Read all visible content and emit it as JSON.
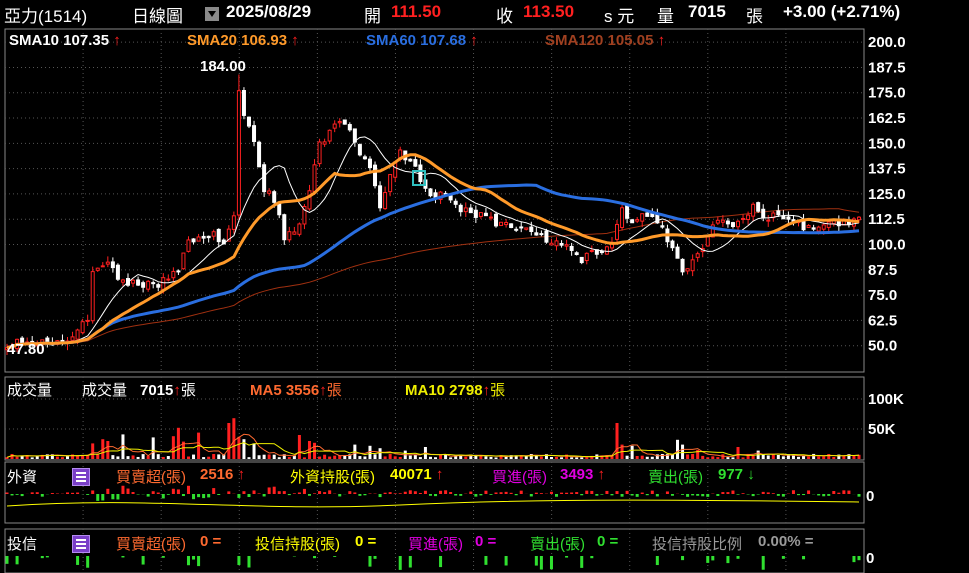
{
  "header": {
    "stock": "亞力(1514)",
    "period": "日線圖",
    "date": "2025/08/29",
    "open_label": "開",
    "open_value": "111.50",
    "close_label": "收",
    "close_value": "113.50",
    "unit_suffix": "s 元",
    "volume_label": "量",
    "volume_value": "7015",
    "volume_unit": "張",
    "change": "+3.00 (+2.71%)"
  },
  "legend": {
    "sma10": "SMA10 107.35",
    "sma20": "SMA20 106.93",
    "sma60": "SMA60 107.68",
    "sma120": "SMA120 105.05"
  },
  "annotations": {
    "high": "184.00",
    "low": "47.80"
  },
  "volume_legend": {
    "panel": "成交量",
    "label": "成交量",
    "value": "7015",
    "unit": "張",
    "ma5": "MA5 3556",
    "ma10": "MA10 2798"
  },
  "foreign_legend": {
    "panel": "外資",
    "net_label": "買賣超(張)",
    "net_value": "2516",
    "hold_label": "外資持股(張)",
    "hold_value": "40071",
    "buy_label": "買進(張)",
    "buy_value": "3493",
    "sell_label": "賣出(張)",
    "sell_value": "977"
  },
  "trust_legend": {
    "panel": "投信",
    "net_label": "買賣超(張)",
    "net_value": "0 =",
    "hold_label": "投信持股(張)",
    "hold_value": "0 =",
    "buy_label": "買進(張)",
    "buy_value": "0 =",
    "sell_label": "賣出(張)",
    "sell_value": "0 =",
    "ratio_label": "投信持股比例",
    "ratio_value": "0.00% ="
  },
  "colors": {
    "up": "#ff2020",
    "down": "#ffffff",
    "sma10": "#ffffff",
    "sma20": "#ff9a2a",
    "sma60": "#2a6ee0",
    "sma120": "#a03010",
    "grid": "#555555",
    "ma5": "#ff6a30",
    "ma10": "#f0f000",
    "buy": "#e000e0",
    "sell": "#30e030",
    "hold": "#ffff00"
  },
  "chart_data": [
    {
      "type": "line",
      "subtype": "candlestick",
      "title": "亞力(1514) 日線圖",
      "ylim": [
        37.5,
        206
      ],
      "y_ticks": [
        200.0,
        187.5,
        175.0,
        162.5,
        150.0,
        137.5,
        125.0,
        112.5,
        100.0,
        87.5,
        75.0,
        62.5,
        50.0
      ],
      "y_tick_labels": [
        "200.0",
        "187.5",
        "175.0",
        "162.5",
        "150.0",
        "137.5",
        "125.0",
        "112.5",
        "100.0",
        "87.5",
        "75.0",
        "62.5",
        "50.0"
      ],
      "grid": true,
      "bars": 170,
      "anchors": [
        [
          0,
          51
        ],
        [
          10,
          52
        ],
        [
          14,
          56
        ],
        [
          16,
          64
        ],
        [
          17,
          86
        ],
        [
          20,
          93
        ],
        [
          22,
          82
        ],
        [
          30,
          80
        ],
        [
          34,
          87
        ],
        [
          36,
          101
        ],
        [
          38,
          104
        ],
        [
          41,
          106
        ],
        [
          43,
          100
        ],
        [
          45,
          116
        ],
        [
          46,
          182
        ],
        [
          47,
          164
        ],
        [
          49,
          150
        ],
        [
          51,
          127
        ],
        [
          53,
          122
        ],
        [
          55,
          104
        ],
        [
          58,
          110
        ],
        [
          60,
          126
        ],
        [
          62,
          150
        ],
        [
          65,
          158
        ],
        [
          67,
          160
        ],
        [
          69,
          150
        ],
        [
          72,
          138
        ],
        [
          74,
          120
        ],
        [
          76,
          134
        ],
        [
          78,
          145
        ],
        [
          80,
          142
        ],
        [
          82,
          133
        ],
        [
          84,
          124
        ],
        [
          87,
          126
        ],
        [
          90,
          118
        ],
        [
          94,
          114
        ],
        [
          98,
          110
        ],
        [
          102,
          107
        ],
        [
          106,
          104
        ],
        [
          110,
          100
        ],
        [
          114,
          93
        ],
        [
          118,
          98
        ],
        [
          120,
          100
        ],
        [
          122,
          118
        ],
        [
          124,
          110
        ],
        [
          127,
          115
        ],
        [
          130,
          107
        ],
        [
          132,
          98
        ],
        [
          134,
          88
        ],
        [
          136,
          92
        ],
        [
          138,
          100
        ],
        [
          140,
          110
        ],
        [
          142,
          114
        ],
        [
          144,
          108
        ],
        [
          146,
          112
        ],
        [
          148,
          119
        ],
        [
          150,
          113
        ],
        [
          153,
          115
        ],
        [
          156,
          110
        ],
        [
          159,
          108
        ],
        [
          162,
          110
        ],
        [
          166,
          111
        ],
        [
          169,
          113.5
        ]
      ],
      "series": [
        {
          "name": "SMA10",
          "last": 107.35,
          "color": "#ffffff"
        },
        {
          "name": "SMA20",
          "last": 106.93,
          "color": "#ff9a2a"
        },
        {
          "name": "SMA60",
          "last": 107.68,
          "color": "#2a6ee0"
        },
        {
          "name": "SMA120",
          "last": 105.05,
          "color": "#a03010"
        }
      ],
      "annotations": [
        {
          "label": "184.00",
          "value": 184.0
        },
        {
          "label": "47.80",
          "value": 47.8
        }
      ]
    },
    {
      "type": "bar",
      "title": "成交量",
      "ylim": [
        0,
        135000
      ],
      "y_ticks": [
        100000,
        50000
      ],
      "y_tick_labels": [
        "100K",
        "50K"
      ],
      "last": 7015,
      "series": [
        {
          "name": "MA5",
          "last": 3556
        },
        {
          "name": "MA10",
          "last": 2798
        }
      ],
      "spikes": [
        [
          17,
          26000
        ],
        [
          19,
          33000
        ],
        [
          20,
          30000
        ],
        [
          23,
          41000
        ],
        [
          29,
          36000
        ],
        [
          33,
          38000
        ],
        [
          34,
          52000
        ],
        [
          35,
          29000
        ],
        [
          38,
          44000
        ],
        [
          44,
          60000
        ],
        [
          45,
          68000
        ],
        [
          46,
          37000
        ],
        [
          47,
          33000
        ],
        [
          49,
          26000
        ],
        [
          58,
          40000
        ],
        [
          60,
          30000
        ],
        [
          61,
          27000
        ],
        [
          69,
          24000
        ],
        [
          72,
          22000
        ],
        [
          74,
          18000
        ],
        [
          79,
          14000
        ],
        [
          83,
          20000
        ],
        [
          121,
          60000
        ],
        [
          122,
          24000
        ],
        [
          124,
          22000
        ],
        [
          133,
          32000
        ],
        [
          134,
          24000
        ],
        [
          137,
          15000
        ],
        [
          145,
          20000
        ],
        [
          149,
          14000
        ]
      ]
    },
    {
      "type": "bar",
      "title": "外資",
      "y_ticks": [
        0
      ],
      "y_tick_labels": [
        "0"
      ],
      "series": [
        {
          "name": "買賣超(張)",
          "last": 2516
        },
        {
          "name": "外資持股(張)",
          "last": 40071
        },
        {
          "name": "買進(張)",
          "last": 3493
        },
        {
          "name": "賣出(張)",
          "last": 977
        }
      ]
    },
    {
      "type": "bar",
      "title": "投信",
      "y_ticks": [
        0
      ],
      "y_tick_labels": [
        "0"
      ],
      "series": [
        {
          "name": "買賣超(張)",
          "last": 0
        },
        {
          "name": "投信持股(張)",
          "last": 0
        },
        {
          "name": "買進(張)",
          "last": 0
        },
        {
          "name": "賣出(張)",
          "last": 0
        }
      ]
    }
  ]
}
